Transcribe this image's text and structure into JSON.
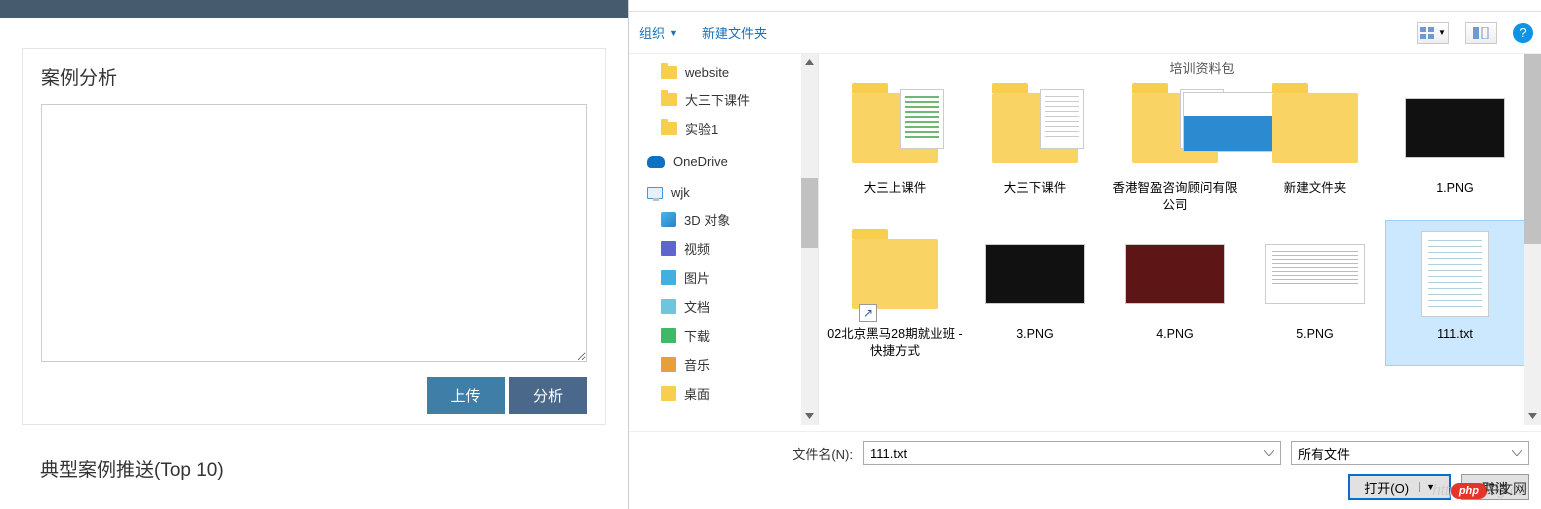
{
  "left": {
    "card_title": "案例分析",
    "textarea_value": "",
    "upload_btn": "上传",
    "analyze_btn": "分析",
    "section_title": "典型案例推送(Top 10)"
  },
  "dialog": {
    "toolbar": {
      "organize": "组织",
      "new_folder": "新建文件夹"
    },
    "tree": [
      {
        "label": "website",
        "type": "folder",
        "level": 2
      },
      {
        "label": "大三下课件",
        "type": "folder",
        "level": 2
      },
      {
        "label": "实验1",
        "type": "folder",
        "level": 2
      },
      {
        "label": "OneDrive",
        "type": "onedrive",
        "level": 1
      },
      {
        "label": "wjk",
        "type": "pc",
        "level": 1
      },
      {
        "label": "3D 对象",
        "type": "3d",
        "level": 2
      },
      {
        "label": "视频",
        "type": "vid",
        "level": 2
      },
      {
        "label": "图片",
        "type": "pic",
        "level": 2
      },
      {
        "label": "文档",
        "type": "doc",
        "level": 2
      },
      {
        "label": "下载",
        "type": "dl",
        "level": 2
      },
      {
        "label": "音乐",
        "type": "mus",
        "level": 2
      },
      {
        "label": "桌面",
        "type": "desk",
        "level": 2
      }
    ],
    "files_header": "培训资料包",
    "files": [
      {
        "name": "大三上课件",
        "kind": "folder-doc"
      },
      {
        "name": "大三下课件",
        "kind": "folder-blank"
      },
      {
        "name": "香港智盈咨询顾问有限公司",
        "kind": "folder-biz"
      },
      {
        "name": "新建文件夹",
        "kind": "folder-empty"
      },
      {
        "name": "1.PNG",
        "kind": "img-dark"
      },
      {
        "name": "02北京黑马28期就业班 - 快捷方式",
        "kind": "folder-shortcut"
      },
      {
        "name": "3.PNG",
        "kind": "img-dark"
      },
      {
        "name": "4.PNG",
        "kind": "img-red"
      },
      {
        "name": "5.PNG",
        "kind": "img-white"
      },
      {
        "name": "111.txt",
        "kind": "text",
        "selected": true
      }
    ],
    "filename_label": "文件名(N):",
    "filename_value": "111.txt",
    "filter_label": "所有文件",
    "open_btn": "打开(O)",
    "cancel_btn": "取消"
  },
  "watermark_url": "https://blog.cs",
  "php_badge": "php",
  "cn_brand": "中文网"
}
